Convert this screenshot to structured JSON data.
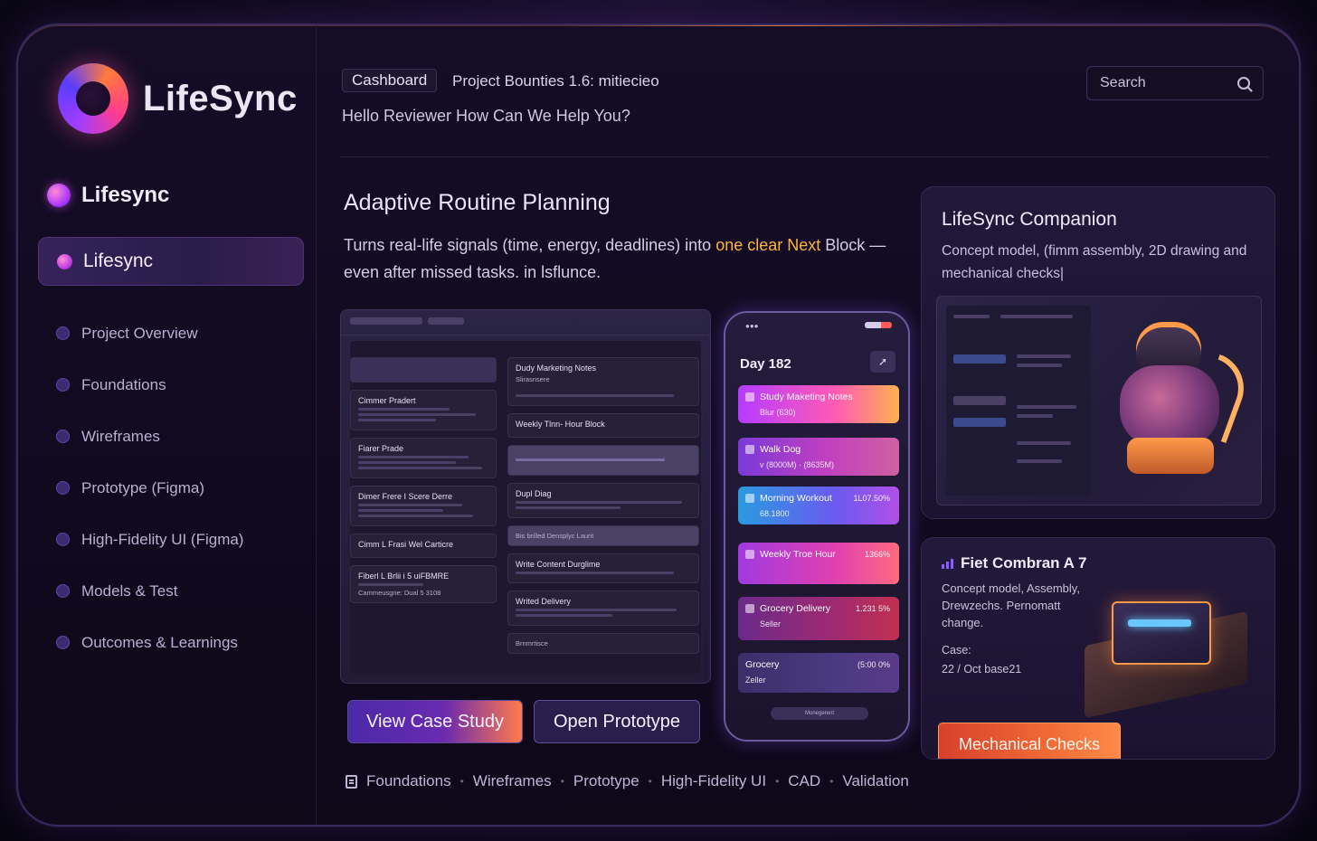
{
  "brand": {
    "name": "LifeSync"
  },
  "sidebar": {
    "workspace_label": "Lifesync",
    "active_item": "Lifesync",
    "items": [
      {
        "label": "Project Overview"
      },
      {
        "label": "Foundations"
      },
      {
        "label": "Wireframes"
      },
      {
        "label": "Prototype (Figma)"
      },
      {
        "label": "High-Fidelity UI (Figma)"
      },
      {
        "label": "Models & Test"
      },
      {
        "label": "Outcomes & Learnings"
      }
    ]
  },
  "header": {
    "tag": "Cashboard",
    "breadcrumb": "Project Bounties 1.6: mitiecieo",
    "greeting": "Hello Reviewer How Can We Help You?",
    "search": {
      "placeholder": "Search",
      "icon": "search-icon"
    }
  },
  "section": {
    "title": "Adaptive Routine Planning",
    "desc_before": "Turns real-life signals (time, energy, deadlines) into ",
    "desc_highlight": "one clear Next",
    "desc_after": " Block — even after missed tasks. in lsflunce.",
    "highlight_color": "#ffb347"
  },
  "desktop_mock": {
    "cards_left": [
      "Cimmer Pradert",
      "Fiarer Prade",
      "Dimer Frere I Scere Derre",
      "Cimm L Frasi Wel Carticre",
      "Fiberl L Brlii i 5 uiFBMRE"
    ],
    "card_note": "Cammeusgne: Dual 5 3108",
    "card_top": "Dudy Marketing Notes",
    "card_top_sub": "Slirasnsere",
    "block_title": "Weekly Tlnn- Hour Block",
    "row1": "Dupl Diag",
    "row2": "Bis brilled Densplyc Laurit",
    "row3": "Write Content Durglime",
    "row4": "Writed Delivery",
    "row5": "Brnmrtisce"
  },
  "phone": {
    "day": "Day 182",
    "tasks": [
      {
        "title": "Study Maketing Notes",
        "sub": "Blur (630)",
        "right": "",
        "gradient": "linear-gradient(90deg,#b43cff,#ff5ab4 60%,#ffb050)"
      },
      {
        "title": "Walk Dog",
        "sub": "v (8000M) · (8635M)",
        "right": "",
        "gradient": "linear-gradient(90deg,#7a3ad8,#c040c0 55%,#d060a0)"
      },
      {
        "title": "Morning Workout",
        "sub": "68.1800",
        "right": "1L07.50%",
        "gradient": "linear-gradient(90deg,#2a9ae0,#6a5af0 60%,#b050e8)"
      },
      {
        "title": "Weekly Troe Hour",
        "sub": "",
        "right": "1366%",
        "gradient": "linear-gradient(90deg,#a03ae0,#e040b0 60%,#ff6a80)"
      },
      {
        "title": "Grocery Delivery",
        "sub": "Seller",
        "right": "1.231 5%",
        "gradient": "linear-gradient(90deg,#6a2a8a,#a02a70 60%,#c03050)"
      },
      {
        "title": "Grocery",
        "sub": "Zeller",
        "right": "(5:00 0%",
        "gradient": "linear-gradient(90deg,#3a2f6a,#4a3a80 60%,#5a3a8a)"
      }
    ],
    "pill": "Monegerent"
  },
  "buttons": {
    "case_study": "View Case Study",
    "prototype": "Open Prototype",
    "mechanical": "Mechanical Checks"
  },
  "footer": {
    "items": [
      "Foundations",
      "Wireframes",
      "Prototype",
      "High-Fidelity UI",
      "CAD",
      "Validation"
    ]
  },
  "companion": {
    "title": "LifeSync Companion",
    "desc": "Concept model, (fimm assembly, 2D drawing and mechanical checks|"
  },
  "fiet": {
    "title": "Fiet Combran A 7",
    "desc": "Concept model, Assembly, Drewzechs. Pernomatt change.",
    "case_label": "Case:",
    "case_value": "22 / Oct base21"
  }
}
